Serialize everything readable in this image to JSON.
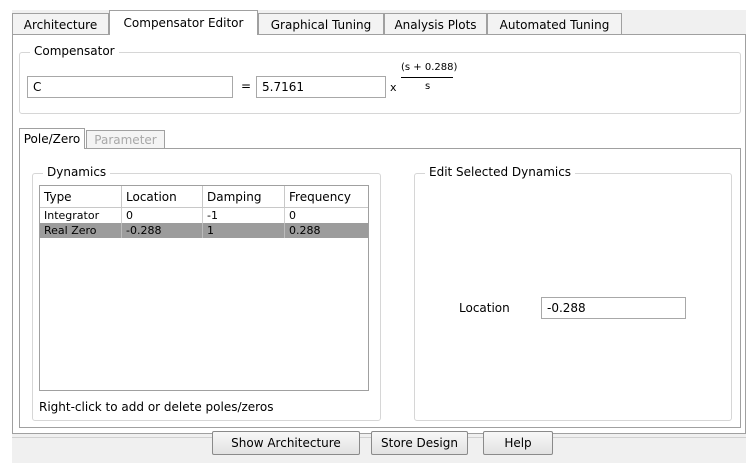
{
  "tabs": [
    {
      "label": "Architecture"
    },
    {
      "label": "Compensator Editor"
    },
    {
      "label": "Graphical Tuning"
    },
    {
      "label": "Analysis Plots"
    },
    {
      "label": "Automated Tuning"
    }
  ],
  "compensator": {
    "group_label": "Compensator",
    "selected": "C",
    "equals": "=",
    "gain": "5.7161",
    "times": "x",
    "numerator": "(s + 0.288)",
    "denominator": "s"
  },
  "subtabs": [
    {
      "label": "Pole/Zero"
    },
    {
      "label": "Parameter"
    }
  ],
  "dynamics": {
    "group_label": "Dynamics",
    "columns": [
      "Type",
      "Location",
      "Damping",
      "Frequency"
    ],
    "rows": [
      {
        "type": "Integrator",
        "location": "0",
        "damping": "-1",
        "frequency": "0"
      },
      {
        "type": "Real Zero",
        "location": "-0.288",
        "damping": "1",
        "frequency": "0.288"
      }
    ],
    "hint": "Right-click to add or delete poles/zeros"
  },
  "edit": {
    "group_label": "Edit Selected Dynamics",
    "location_label": "Location",
    "location_value": "-0.288"
  },
  "buttons": {
    "show_architecture": "Show Architecture",
    "store_design": "Store Design",
    "help": "Help"
  }
}
